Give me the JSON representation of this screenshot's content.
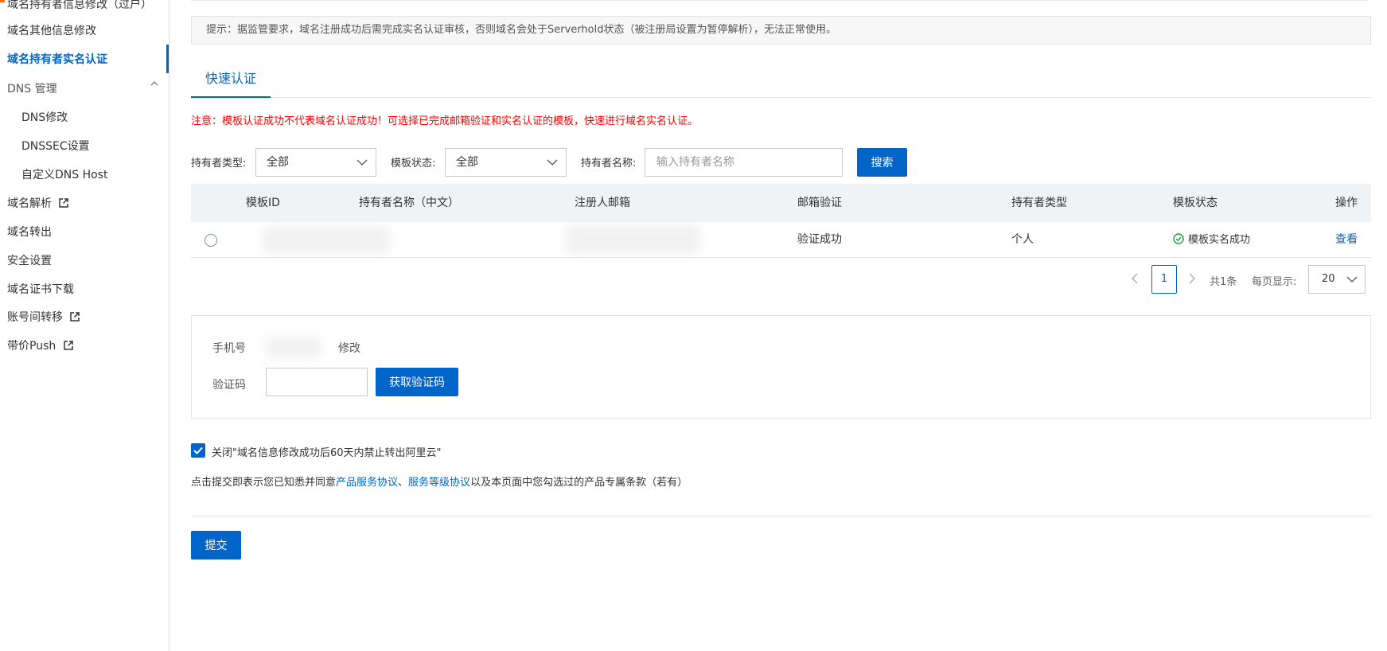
{
  "sidebar": {
    "items": [
      {
        "label": "域名持有者信息修改（过户）"
      },
      {
        "label": "域名其他信息修改"
      },
      {
        "label": "域名持有者实名认证"
      },
      {
        "label": "DNS 管理"
      },
      {
        "label": "DNS修改"
      },
      {
        "label": "DNSSEC设置"
      },
      {
        "label": "自定义DNS Host"
      },
      {
        "label": "域名解析"
      },
      {
        "label": "域名转出"
      },
      {
        "label": "安全设置"
      },
      {
        "label": "域名证书下载"
      },
      {
        "label": "账号间转移"
      },
      {
        "label": "带价Push"
      }
    ]
  },
  "notice": "提示：据监管要求，域名注册成功后需完成实名认证审核，否则域名会处于Serverhold状态（被注册局设置为暂停解析），无法正常使用。",
  "tab": "快速认证",
  "warning": "注意：模板认证成功不代表域名认证成功！可选择已完成邮箱验证和实名认证的模板，快速进行域名实名认证。",
  "filters": {
    "holder_type_label": "持有者类型:",
    "holder_type_value": "全部",
    "template_status_label": "模板状态:",
    "template_status_value": "全部",
    "holder_name_label": "持有者名称:",
    "holder_name_placeholder": "输入持有者名称",
    "search_button": "搜索"
  },
  "table": {
    "headers": [
      "模板ID",
      "持有者名称（中文）",
      "注册人邮箱",
      "邮箱验证",
      "持有者类型",
      "模板状态",
      "操作"
    ],
    "rows": [
      {
        "email_verify": "验证成功",
        "holder_type": "个人",
        "template_status": "模板实名成功",
        "action": "查看"
      }
    ]
  },
  "pagination": {
    "current_page": "1",
    "total": "共1条",
    "per_page_label": "每页显示:",
    "per_page_value": "20"
  },
  "phone": {
    "phone_label": "手机号",
    "modify_link": "修改",
    "code_label": "验证码",
    "get_code_button": "获取验证码"
  },
  "checkbox_label": "关闭\"域名信息修改成功后60天内禁止转出阿里云\"",
  "agreement": {
    "prefix": "点击提交即表示您已知悉并同意",
    "link1": "产品服务协议",
    "sep": "、",
    "link2": "服务等级协议",
    "suffix": "以及本页面中您勾选过的产品专属条款（若有）"
  },
  "submit_button": "提交",
  "colors": {
    "primary": "#0064c8",
    "warning": "#ff0000",
    "success": "#1a9f3a"
  }
}
